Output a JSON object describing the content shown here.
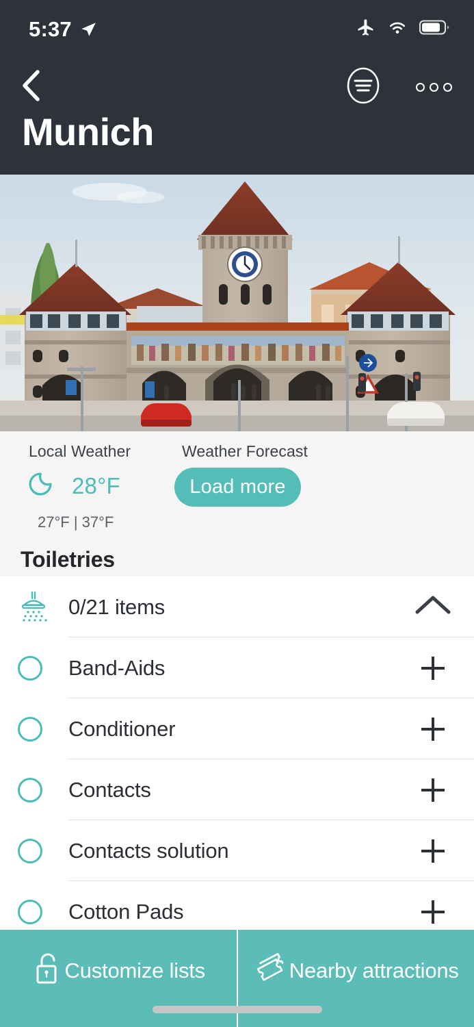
{
  "statusbar": {
    "time": "5:37",
    "location_icon": "location-arrow-icon",
    "airplane_icon": "airplane-mode-icon",
    "wifi_icon": "wifi-icon",
    "battery_icon": "battery-icon"
  },
  "navbar": {
    "back_icon": "chevron-left-icon",
    "list_icon": "circled-list-icon",
    "overflow_icon": "more-options-icon",
    "title": "Munich"
  },
  "hero": {
    "alt": "Isartor gate Munich photo",
    "landmark": "Isartor"
  },
  "weather": {
    "local_label": "Local Weather",
    "forecast_label": "Weather Forecast",
    "condition_icon": "crescent-moon-icon",
    "current_temp": "28°F",
    "range": "27°F | 37°F",
    "load_more_label": "Load more",
    "accent": "#55bdb8"
  },
  "section": {
    "title": "Toiletries",
    "icon": "shower-head-icon",
    "count_label": "0/21 items",
    "collapse_icon": "chevron-up-icon"
  },
  "items": [
    {
      "label": "Band-Aids",
      "checkbox_icon": "circle-unchecked-icon",
      "add_icon": "plus-icon"
    },
    {
      "label": "Conditioner",
      "checkbox_icon": "circle-unchecked-icon",
      "add_icon": "plus-icon"
    },
    {
      "label": "Contacts",
      "checkbox_icon": "circle-unchecked-icon",
      "add_icon": "plus-icon"
    },
    {
      "label": "Contacts solution",
      "checkbox_icon": "circle-unchecked-icon",
      "add_icon": "plus-icon"
    },
    {
      "label": "Cotton Pads",
      "checkbox_icon": "circle-unchecked-icon",
      "add_icon": "plus-icon"
    }
  ],
  "bottombar": {
    "customize_label": "Customize lists",
    "customize_icon": "unlocked-padlock-icon",
    "attractions_label": "Nearby attractions",
    "attractions_icon": "tickets-icon",
    "background": "#5cbcb8"
  },
  "theme": {
    "dark_chrome": "#2e333b",
    "teal": "#4cbcb6",
    "page_bg": "#f5f5f5"
  }
}
